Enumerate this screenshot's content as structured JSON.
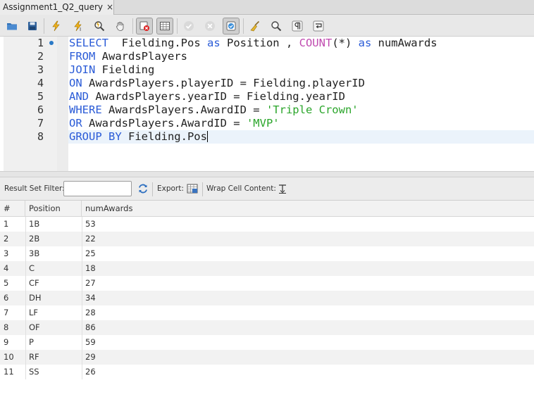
{
  "tab": {
    "title": "Assignment1_Q2_query",
    "close_glyph": "×"
  },
  "toolbar": {
    "icons": [
      "open-folder-icon",
      "save-icon",
      "execute-icon",
      "execute-current-icon",
      "explain-icon",
      "stop-icon",
      "toggle-continue-on-error-icon",
      "toggle-output-icon",
      "commit-icon",
      "rollback-icon",
      "autocommit-icon",
      "beautify-icon",
      "find-icon",
      "invisible-chars-icon",
      "wrap-lines-icon"
    ]
  },
  "editor": {
    "line_numbers": [
      "1",
      "2",
      "3",
      "4",
      "5",
      "6",
      "7",
      "8"
    ],
    "lines": [
      [
        {
          "t": "SELECT",
          "c": "kw"
        },
        {
          "t": "  Fielding.Pos ",
          "c": ""
        },
        {
          "t": "as",
          "c": "kw"
        },
        {
          "t": " Position , ",
          "c": ""
        },
        {
          "t": "COUNT",
          "c": "fn"
        },
        {
          "t": "(*) ",
          "c": ""
        },
        {
          "t": "as",
          "c": "kw"
        },
        {
          "t": " numAwards",
          "c": ""
        }
      ],
      [
        {
          "t": "FROM",
          "c": "kw"
        },
        {
          "t": " AwardsPlayers",
          "c": ""
        }
      ],
      [
        {
          "t": "JOIN",
          "c": "kw"
        },
        {
          "t": " Fielding",
          "c": ""
        }
      ],
      [
        {
          "t": "ON",
          "c": "kw"
        },
        {
          "t": " AwardsPlayers.playerID = Fielding.playerID",
          "c": ""
        }
      ],
      [
        {
          "t": "AND",
          "c": "kw"
        },
        {
          "t": " AwardsPlayers.yearID = Fielding.yearID",
          "c": ""
        }
      ],
      [
        {
          "t": "WHERE",
          "c": "kw"
        },
        {
          "t": " AwardsPlayers.AwardID = ",
          "c": ""
        },
        {
          "t": "'Triple Crown'",
          "c": "str"
        }
      ],
      [
        {
          "t": "OR",
          "c": "kw"
        },
        {
          "t": " AwardsPlayers.AwardID = ",
          "c": ""
        },
        {
          "t": "'MVP'",
          "c": "str"
        }
      ],
      [
        {
          "t": "GROUP BY",
          "c": "kw"
        },
        {
          "t": " Fielding.Pos",
          "c": ""
        }
      ]
    ],
    "current_line": 8,
    "colors": {
      "keyword": "#2a5bd7",
      "function": "#c04bb0",
      "string": "#2aa52a",
      "marker": "#2a79c6"
    }
  },
  "results": {
    "filter_label": "Result Set Filter:",
    "filter_value": "",
    "export_label": "Export:",
    "wrap_label": "Wrap Cell Content:",
    "columns": [
      "#",
      "Position",
      "numAwards"
    ],
    "rows": [
      [
        "1",
        "1B",
        "53"
      ],
      [
        "2",
        "2B",
        "22"
      ],
      [
        "3",
        "3B",
        "25"
      ],
      [
        "4",
        "C",
        "18"
      ],
      [
        "5",
        "CF",
        "27"
      ],
      [
        "6",
        "DH",
        "34"
      ],
      [
        "7",
        "LF",
        "28"
      ],
      [
        "8",
        "OF",
        "86"
      ],
      [
        "9",
        "P",
        "59"
      ],
      [
        "10",
        "RF",
        "29"
      ],
      [
        "11",
        "SS",
        "26"
      ]
    ]
  }
}
